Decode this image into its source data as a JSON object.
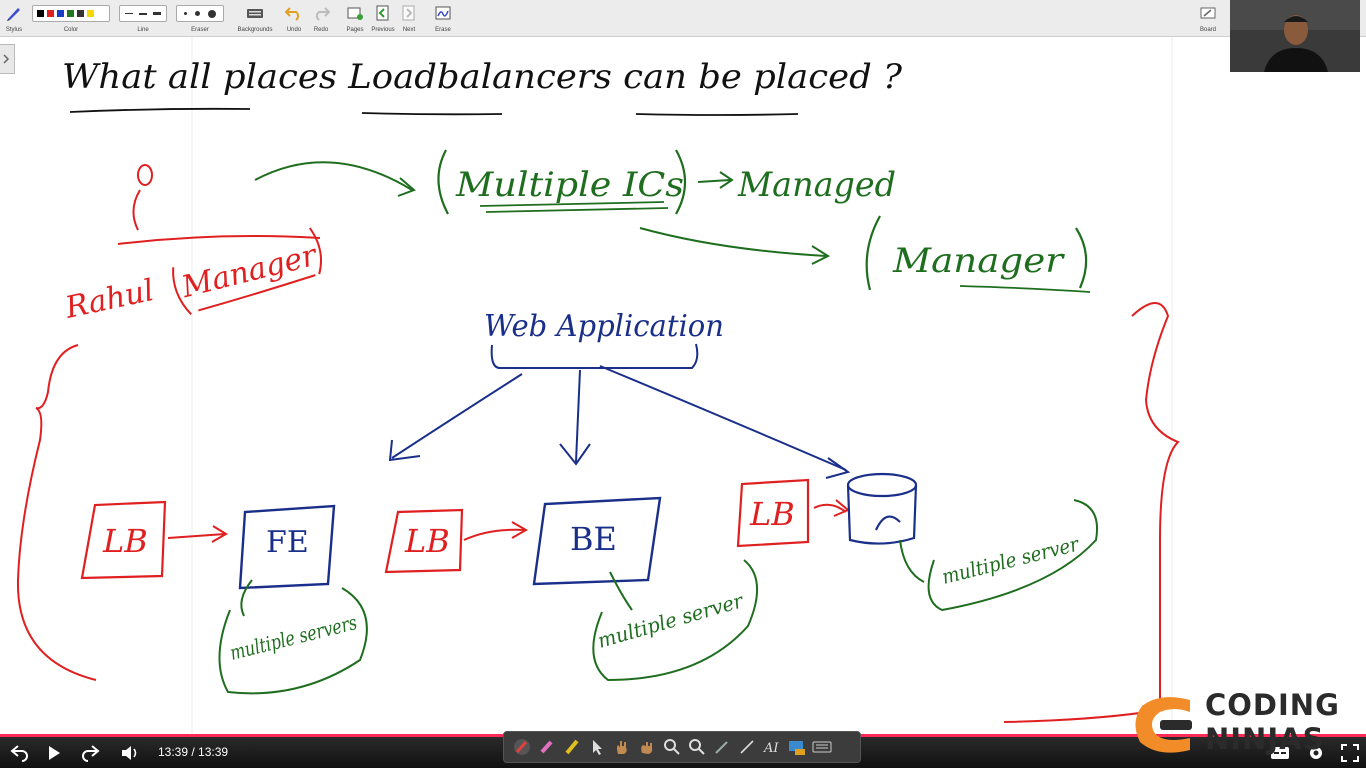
{
  "toolbar": {
    "stylus_label": "Stylus",
    "color_label": "Color",
    "line_label": "Line",
    "eraser_label": "Eraser",
    "backgrounds_label": "Backgrounds",
    "undo_label": "Undo",
    "redo_label": "Redo",
    "pages_label": "Pages",
    "previous_label": "Previous",
    "next_label": "Next",
    "erase_label": "Erase",
    "board_label": "Board",
    "colors": [
      "#000000",
      "#e02020",
      "#1a3cc8",
      "#1f7a1f",
      "#333333",
      "#f5d800"
    ]
  },
  "whiteboard": {
    "title": "What all places Loadbalancers can be placed ?",
    "user_label": "Rahul",
    "role_left": "Manager",
    "multiple_ics": "Multiple ICs",
    "managed": "Managed",
    "role_right": "Manager",
    "web_app": "Web Application",
    "lb_label": "LB",
    "fe_label": "FE",
    "be_label": "BE",
    "fe_note": "multiple servers",
    "be_note": "multiple server",
    "db_note": "multiple server"
  },
  "player": {
    "time": "13:39 / 13:39",
    "progress": 1.0
  },
  "brand": {
    "line1": "CODING",
    "line2": "NINJAS"
  },
  "colors": {
    "ink_black": "#111111",
    "ink_red": "#e02020",
    "ink_green": "#1f6e1f",
    "ink_blue": "#1a2f8a",
    "brand_orange": "#f28c28"
  }
}
